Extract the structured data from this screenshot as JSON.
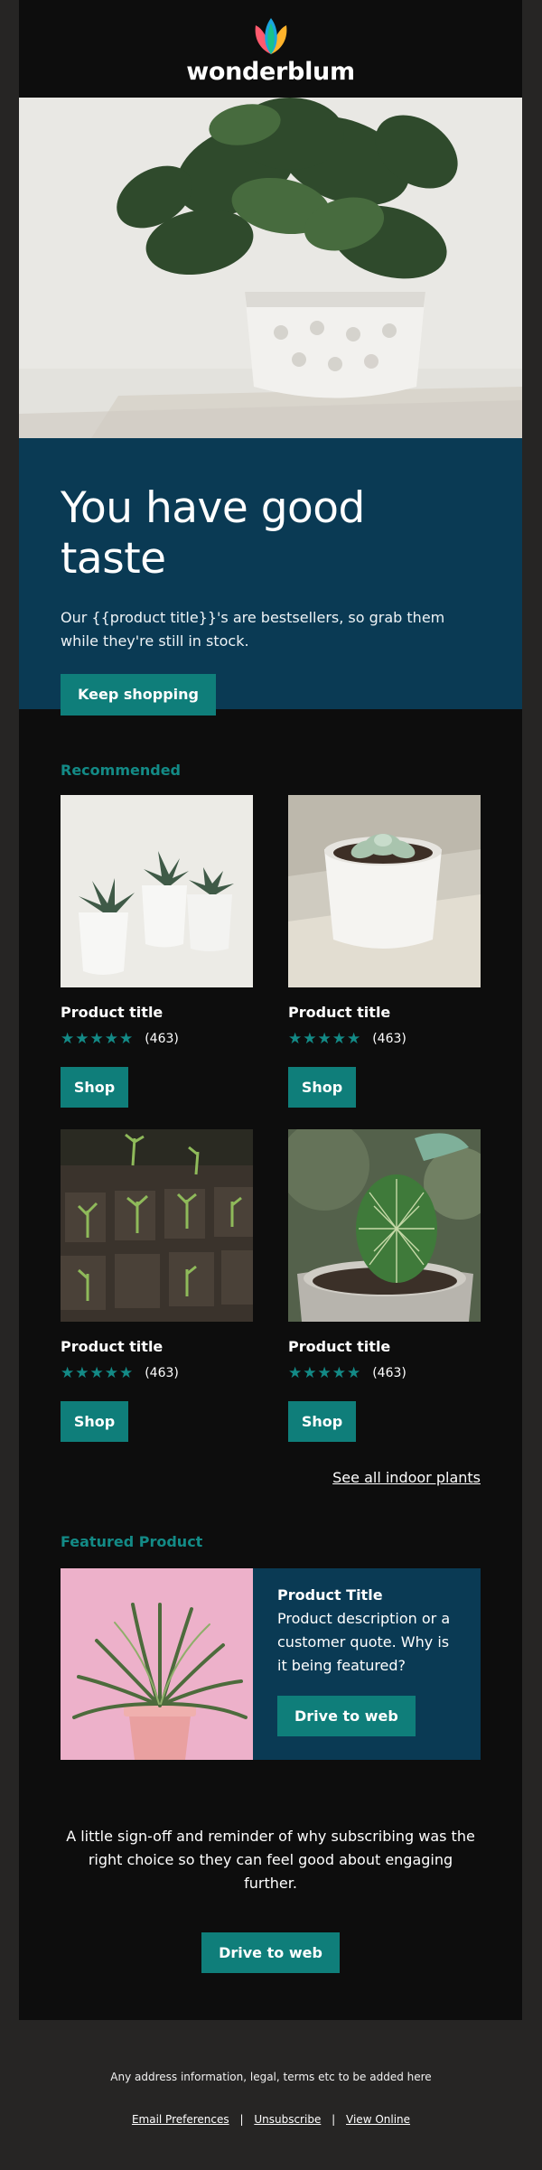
{
  "brand": {
    "name": "wonderblum"
  },
  "hero": {
    "headline": "You have good taste",
    "body": "Our {{product title}}'s are bestsellers, so grab them while they're still in stock.",
    "cta": "Keep shopping"
  },
  "recommended": {
    "label": "Recommended",
    "products": [
      {
        "title": "Product title",
        "stars": "★★★★★",
        "reviews": "(463)",
        "cta": "Shop",
        "image": "succulents-in-white-pots"
      },
      {
        "title": "Product title",
        "stars": "★★★★★",
        "reviews": "(463)",
        "cta": "Shop",
        "image": "succulent-in-white-cup"
      },
      {
        "title": "Product title",
        "stars": "★★★★★",
        "reviews": "(463)",
        "cta": "Shop",
        "image": "seedling-tray"
      },
      {
        "title": "Product title",
        "stars": "★★★★★",
        "reviews": "(463)",
        "cta": "Shop",
        "image": "cactus-in-pot"
      }
    ],
    "see_all": "See all indoor plants"
  },
  "featured": {
    "label": "Featured Product",
    "title": "Product Title",
    "description": "Product description or a customer quote. Why is it being featured?",
    "cta": "Drive to web"
  },
  "signoff": {
    "text": "A little sign-off and reminder of why subscribing was the right choice so they can feel good about engaging further.",
    "cta": "Drive to web"
  },
  "footer": {
    "address": "Any address information, legal, terms etc to be added here",
    "links": [
      "Email Preferences",
      "Unsubscribe",
      "View Online"
    ],
    "separator": "|"
  },
  "colors": {
    "accent": "#0f7e7a",
    "navy": "#0a3a54",
    "background": "#0d0d0d",
    "outer": "#262524"
  }
}
